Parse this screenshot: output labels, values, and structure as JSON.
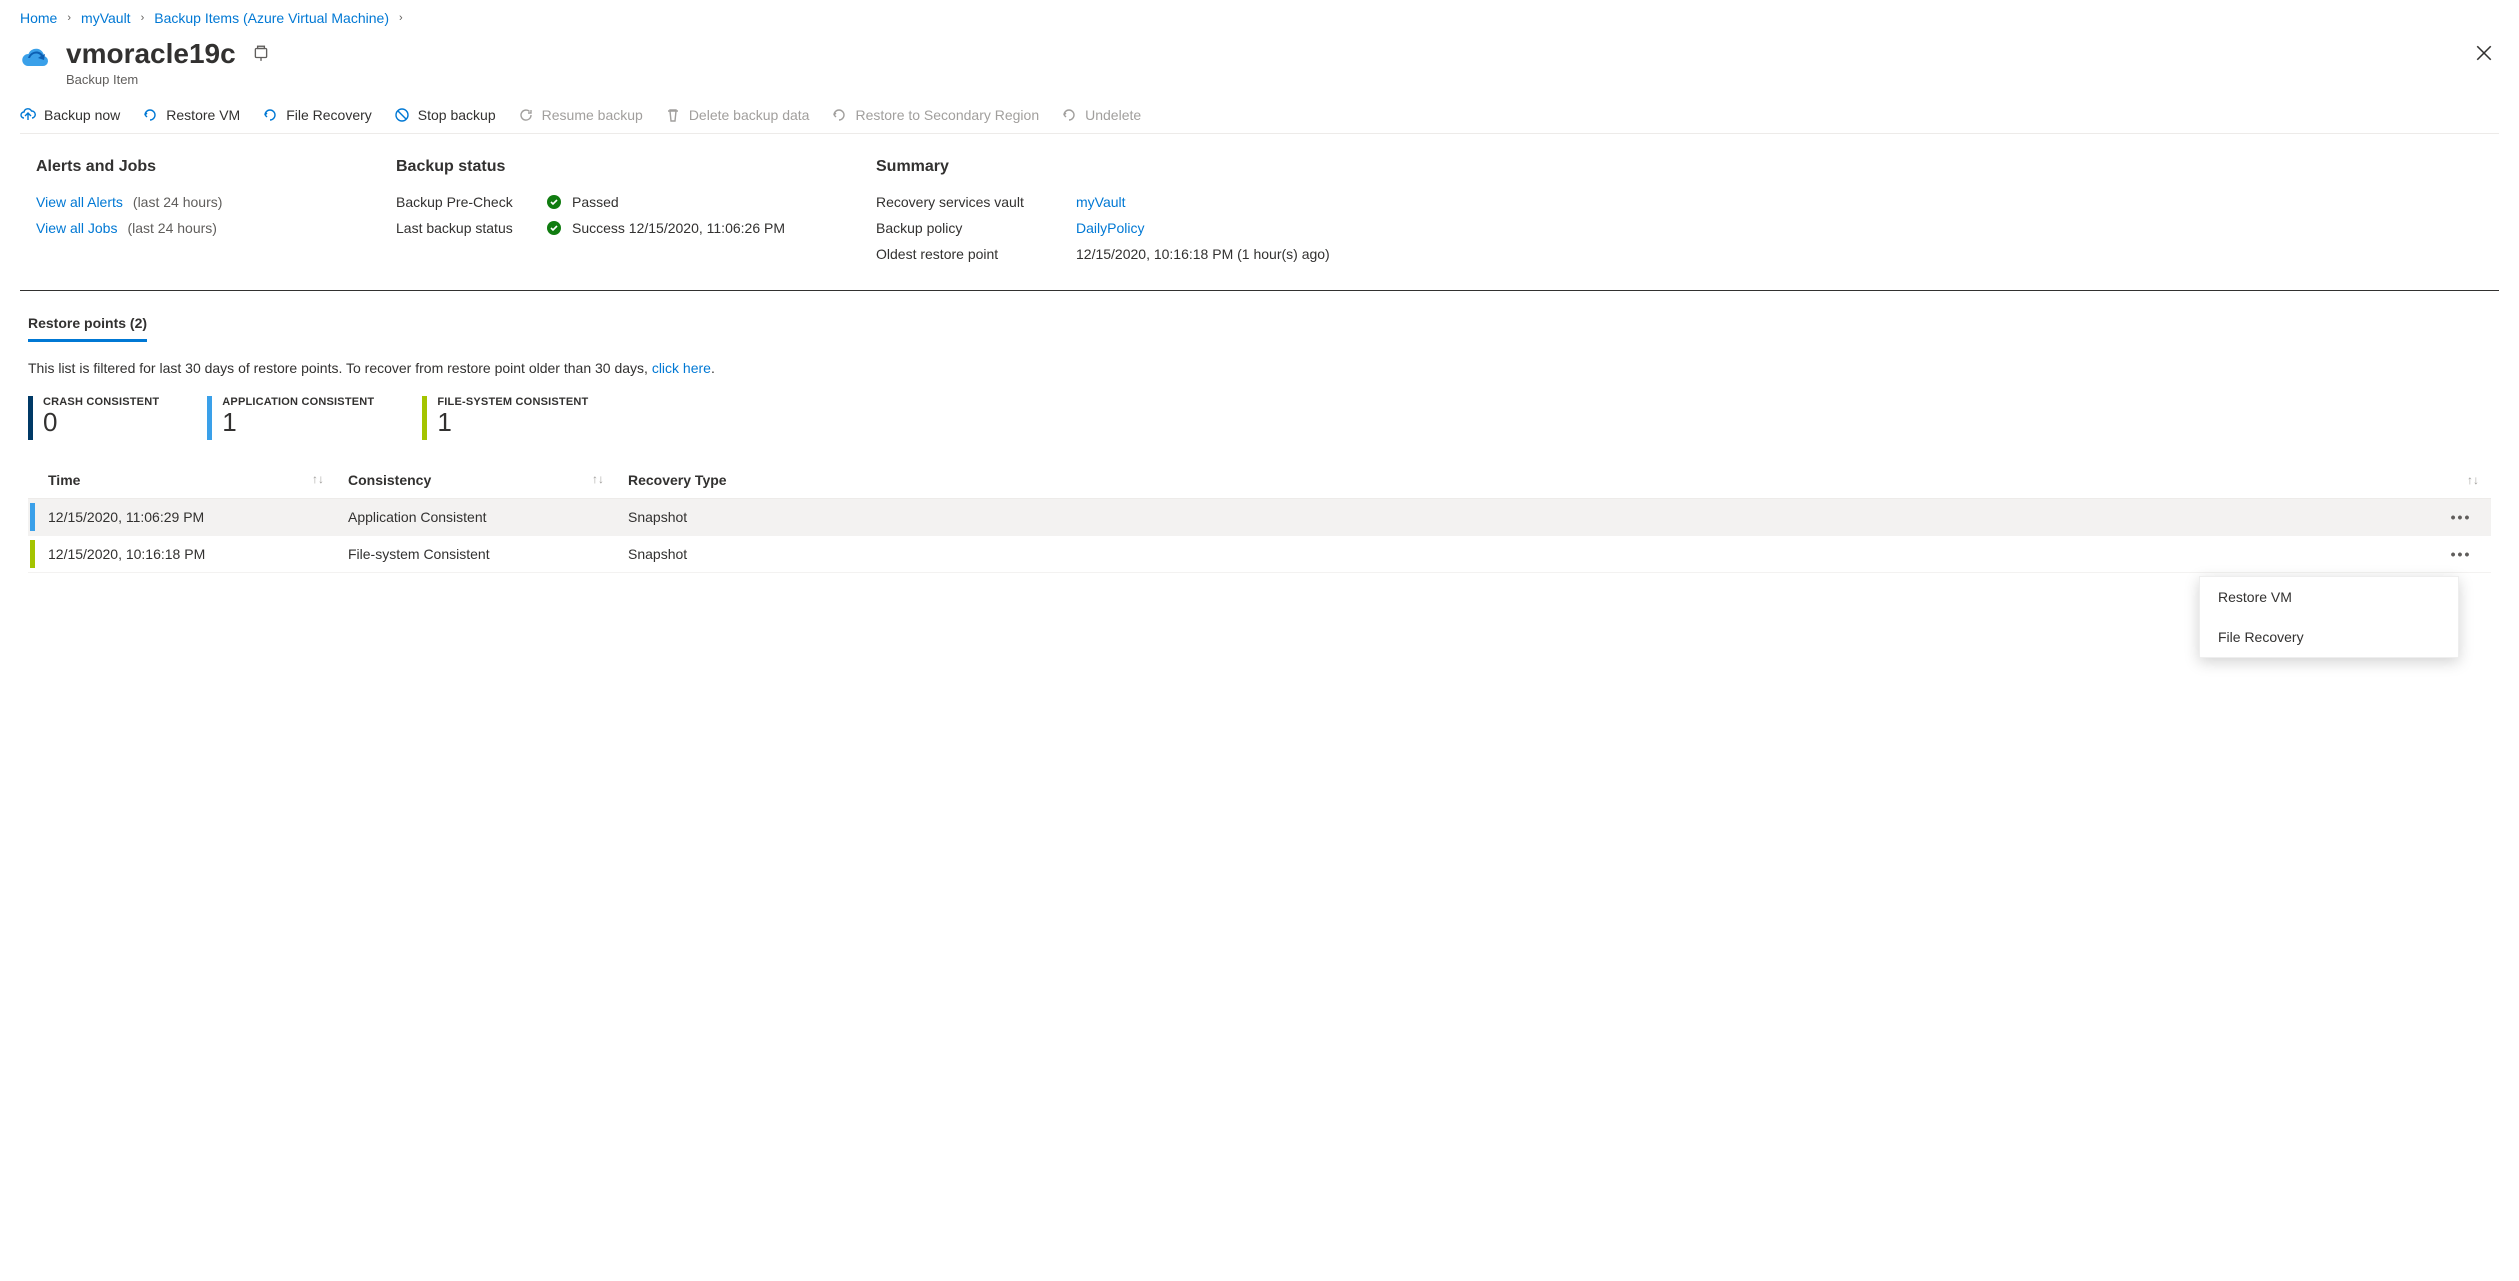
{
  "breadcrumb": {
    "items": [
      "Home",
      "myVault",
      "Backup Items (Azure Virtual Machine)"
    ]
  },
  "header": {
    "title": "vmoracle19c",
    "subtitle": "Backup Item"
  },
  "toolbar": {
    "backup_now": "Backup now",
    "restore_vm": "Restore VM",
    "file_recovery": "File Recovery",
    "stop_backup": "Stop backup",
    "resume_backup": "Resume backup",
    "delete_backup_data": "Delete backup data",
    "restore_secondary": "Restore to Secondary Region",
    "undelete": "Undelete"
  },
  "alerts_jobs": {
    "title": "Alerts and Jobs",
    "view_alerts": "View all Alerts",
    "view_jobs": "View all Jobs",
    "window": "(last 24 hours)"
  },
  "backup_status": {
    "title": "Backup status",
    "precheck_label": "Backup Pre-Check",
    "precheck_value": "Passed",
    "last_status_label": "Last backup status",
    "last_status_value": "Success 12/15/2020, 11:06:26 PM"
  },
  "summary": {
    "title": "Summary",
    "vault_label": "Recovery services vault",
    "vault_value": "myVault",
    "policy_label": "Backup policy",
    "policy_value": "DailyPolicy",
    "oldest_label": "Oldest restore point",
    "oldest_value": "12/15/2020, 10:16:18 PM (1 hour(s) ago)"
  },
  "restore_points": {
    "tab_label": "Restore points (2)",
    "filter_note_prefix": "This list is filtered for last 30 days of restore points. To recover from restore point older than 30 days, ",
    "filter_note_link": "click here",
    "filter_note_suffix": ".",
    "legend": {
      "crash": {
        "label": "CRASH CONSISTENT",
        "count": "0"
      },
      "app": {
        "label": "APPLICATION CONSISTENT",
        "count": "1"
      },
      "fs": {
        "label": "FILE-SYSTEM CONSISTENT",
        "count": "1"
      }
    },
    "columns": {
      "time": "Time",
      "consistency": "Consistency",
      "recovery_type": "Recovery Type"
    },
    "rows": [
      {
        "time": "12/15/2020, 11:06:29 PM",
        "consistency": "Application Consistent",
        "recovery_type": "Snapshot",
        "bar": "blue"
      },
      {
        "time": "12/15/2020, 10:16:18 PM",
        "consistency": "File-system Consistent",
        "recovery_type": "Snapshot",
        "bar": "green"
      }
    ]
  },
  "context_menu": {
    "restore_vm": "Restore VM",
    "file_recovery": "File Recovery"
  }
}
